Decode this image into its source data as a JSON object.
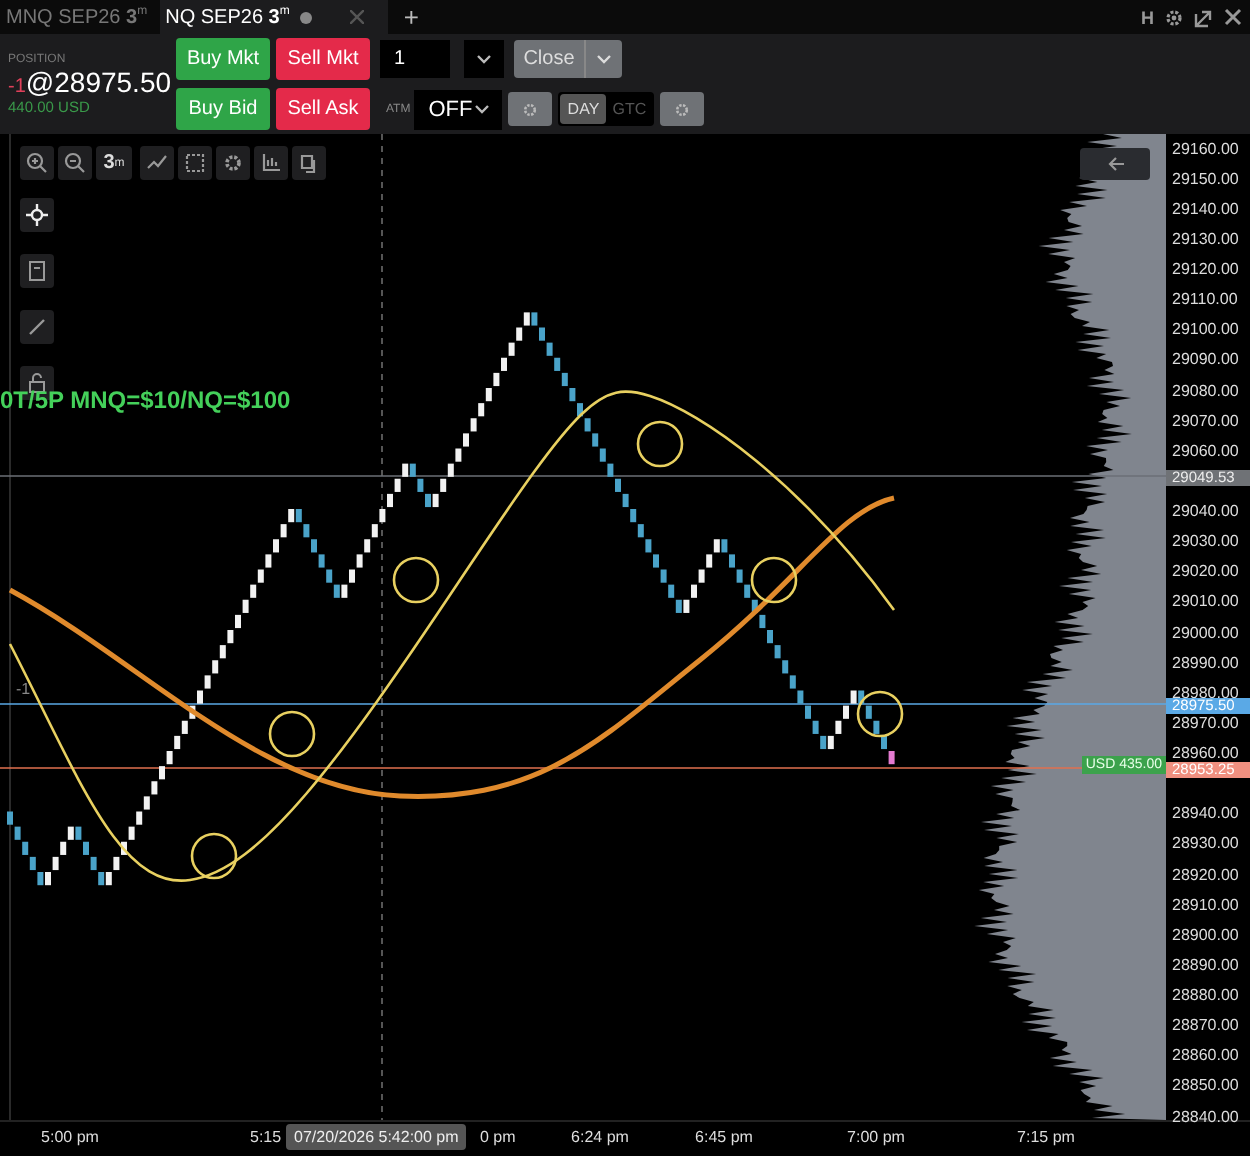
{
  "tabs": [
    {
      "label": "MNQ SEP26",
      "interval": "3",
      "unit": "m",
      "selected": false
    },
    {
      "label": "NQ SEP26",
      "interval": "3",
      "unit": "m",
      "selected": true
    }
  ],
  "add_tab": "+",
  "window_buttons": [
    {
      "kind": "text",
      "label": "H"
    },
    {
      "kind": "settings"
    },
    {
      "kind": "popout"
    },
    {
      "kind": "close"
    }
  ],
  "position": {
    "label": "POSITION",
    "quantity": "-1",
    "price": "@28975.50",
    "pnl": "440.00 USD"
  },
  "order_buttons": [
    {
      "label": "Buy Mkt",
      "kind": "buy"
    },
    {
      "label": "Sell Mkt",
      "kind": "sell"
    },
    {
      "label": "Buy Bid",
      "kind": "buy"
    },
    {
      "label": "Sell Ask",
      "kind": "sell"
    }
  ],
  "quantity": {
    "value": "1"
  },
  "close_button": {
    "label": "Close"
  },
  "atm": {
    "label": "ATM",
    "value": "OFF"
  },
  "time_in_force": [
    {
      "label": "DAY",
      "selected": true
    },
    {
      "label": "GTC",
      "selected": false
    }
  ],
  "chart": {
    "toolbar": {
      "interval": "3",
      "unit": "m"
    },
    "strategy_label": "0T/5P MNQ=$10/NQ=$100",
    "position_marker": "-1",
    "price_axis": [
      "29160.00",
      "29150.00",
      "29140.00",
      "29130.00",
      "29120.00",
      "29110.00",
      "29100.00",
      "29090.00",
      "29080.00",
      "29070.00",
      "29060.00",
      "29040.00",
      "29030.00",
      "29020.00",
      "29010.00",
      "29000.00",
      "28990.00",
      "28980.00",
      "28970.00",
      "28960.00",
      "28940.00",
      "28930.00",
      "28920.00",
      "28910.00",
      "28900.00",
      "28890.00",
      "28880.00",
      "28870.00",
      "28860.00",
      "28850.00",
      "28840.00"
    ],
    "price_tags": [
      {
        "value": "29049.53",
        "kind": "crosshair"
      },
      {
        "value": "28975.50",
        "kind": "position"
      },
      {
        "value": "28953.25",
        "kind": "last"
      }
    ],
    "pnl_tag": "USD 435.00",
    "time_axis": [
      "5:00 pm",
      "5:15",
      "0 pm",
      "6:24 pm",
      "6:45 pm",
      "7:00 pm",
      "7:15 pm"
    ],
    "crosshair_time": "07/20/2026 5:42:00 pm"
  }
}
